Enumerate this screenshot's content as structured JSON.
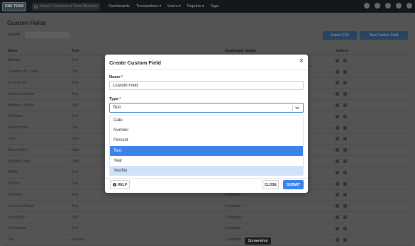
{
  "topnav": {
    "logo_text": "ONE TEAM",
    "search_placeholder": "Search Customers & Team Members",
    "menu": [
      "Dashboards",
      "Transactions ▾",
      "Users ▾",
      "Reports ▾",
      "Tags"
    ]
  },
  "page": {
    "title": "Custom Fields",
    "search_label": "Search",
    "export_button": "Export CSV",
    "new_button": "New Custom Field",
    "columns": [
      "Name",
      "Type",
      "",
      "Gatekeeper Status",
      "Actions"
    ],
    "rows": [
      [
        "Birthday",
        "Text",
        "",
        ""
      ],
      [
        "Customer ID - Note",
        "Text",
        "",
        ""
      ],
      [
        "Account No",
        "Text",
        "",
        ""
      ],
      [
        "Contract Number",
        "Text",
        "",
        ""
      ],
      [
        "Address - Street",
        "Text",
        "",
        ""
      ],
      [
        "City/State",
        "Text",
        "",
        ""
      ],
      [
        "Street Name",
        "Text",
        "",
        ""
      ],
      [
        "Date",
        "Date",
        "",
        ""
      ],
      [
        "Date of Birth",
        "Date",
        "",
        ""
      ],
      [
        "Effective Date",
        "Date",
        "",
        ""
      ],
      [
        "EIN/ID",
        "Text",
        "",
        ""
      ],
      [
        "HOA ID",
        "Text",
        "",
        ""
      ],
      [
        "HOA Fee",
        "Text",
        "",
        "0 principle"
      ],
      [
        "Insurance Name",
        "Text",
        "",
        "0 principle"
      ],
      [
        "Insured By",
        "Text",
        "",
        "0 principle"
      ],
      [
        "Lot Number",
        "Text",
        "",
        "0 principle"
      ],
      [
        "Tax",
        "Percent",
        "",
        "0 principle"
      ]
    ]
  },
  "modal": {
    "title": "Create Custom Field",
    "close_glyph": "×",
    "name_label": "Name",
    "name_value": "Custom Field",
    "type_label": "Type",
    "required_mark": "*",
    "type_value": "Text",
    "type_options": [
      "Date",
      "Number",
      "Percent",
      "Text",
      "Year",
      "Yes/No"
    ],
    "selected_option": "Text",
    "hovered_option": "Yes/No",
    "help_label": "HELP",
    "close_label": "CLOSE",
    "submit_label": "SUBMIT"
  },
  "tooltip": "Screenshot",
  "colors": {
    "accent": "#3b82ea",
    "hover": "#cfe2f7",
    "required": "#d9363e"
  }
}
